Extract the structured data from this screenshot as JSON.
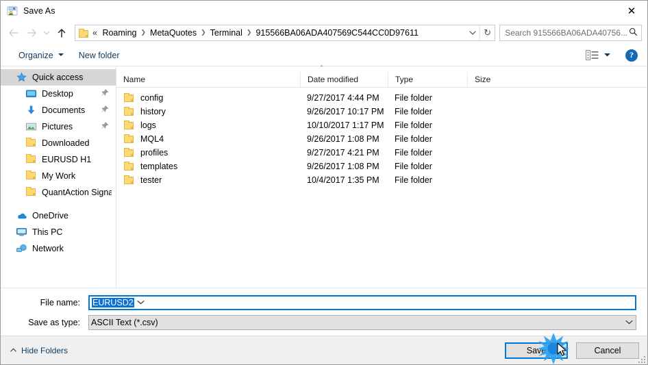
{
  "window": {
    "title": "Save As",
    "title_icon": "save-as-icon",
    "close_label": "✕"
  },
  "nav": {
    "back_icon": "arrow-left-icon",
    "forward_icon": "arrow-right-icon",
    "recent_icon": "chevron-down-icon",
    "up_icon": "arrow-up-icon",
    "address": {
      "folder_icon": "folder-icon",
      "leading": "«",
      "crumbs": [
        "Roaming",
        "MetaQuotes",
        "Terminal",
        "915566BA06ADA407569C544CC0D97611"
      ],
      "separator": "❯",
      "dropdown_icon": "chevron-down-icon",
      "refresh_icon": "refresh-icon",
      "refresh_glyph": "↻"
    },
    "search": {
      "placeholder": "Search 915566BA06ADA40756...",
      "icon": "search-icon",
      "glyph": "⚲"
    }
  },
  "command_bar": {
    "organize": "Organize",
    "new_folder": "New folder",
    "caret": "▼",
    "view_icon": "view-options-icon",
    "view_caret": "▼",
    "help_label": "?"
  },
  "sidebar": {
    "items": [
      {
        "label": "Quick access",
        "icon": "star-pin-icon",
        "selected": true,
        "indent": false,
        "pinned": false
      },
      {
        "label": "Desktop",
        "icon": "desktop-icon",
        "selected": false,
        "indent": true,
        "pinned": true
      },
      {
        "label": "Documents",
        "icon": "documents-icon",
        "selected": false,
        "indent": true,
        "pinned": true
      },
      {
        "label": "Pictures",
        "icon": "pictures-icon",
        "selected": false,
        "indent": true,
        "pinned": true
      },
      {
        "label": "Downloaded",
        "icon": "folder-icon",
        "selected": false,
        "indent": true,
        "pinned": false
      },
      {
        "label": "EURUSD H1",
        "icon": "folder-icon",
        "selected": false,
        "indent": true,
        "pinned": false
      },
      {
        "label": "My Work",
        "icon": "folder-icon",
        "selected": false,
        "indent": true,
        "pinned": false
      },
      {
        "label": "QuantAction Signal",
        "icon": "folder-icon",
        "selected": false,
        "indent": true,
        "pinned": false
      }
    ],
    "roots": [
      {
        "label": "OneDrive",
        "icon": "onedrive-icon"
      },
      {
        "label": "This PC",
        "icon": "this-pc-icon"
      },
      {
        "label": "Network",
        "icon": "network-icon"
      }
    ],
    "pin_glyph": "📌"
  },
  "file_list": {
    "sort_indicator": "˄",
    "columns": [
      "Name",
      "Date modified",
      "Type",
      "Size"
    ],
    "rows": [
      {
        "name": "config",
        "date": "9/27/2017 4:44 PM",
        "type": "File folder",
        "size": ""
      },
      {
        "name": "history",
        "date": "9/26/2017 10:17 PM",
        "type": "File folder",
        "size": ""
      },
      {
        "name": "logs",
        "date": "10/10/2017 1:17 PM",
        "type": "File folder",
        "size": ""
      },
      {
        "name": "MQL4",
        "date": "9/26/2017 1:08 PM",
        "type": "File folder",
        "size": ""
      },
      {
        "name": "profiles",
        "date": "9/27/2017 4:21 PM",
        "type": "File folder",
        "size": ""
      },
      {
        "name": "templates",
        "date": "9/26/2017 1:08 PM",
        "type": "File folder",
        "size": ""
      },
      {
        "name": "tester",
        "date": "10/4/2017 1:35 PM",
        "type": "File folder",
        "size": ""
      }
    ]
  },
  "form": {
    "file_name_label": "File name:",
    "file_name_value": "EURUSD2",
    "save_type_label": "Save as type:",
    "save_type_value": "ASCII Text (*.csv)",
    "chevron": "⌄"
  },
  "footer": {
    "hide_folders": "Hide Folders",
    "hide_caret": "˄",
    "save": "Save",
    "cancel": "Cancel"
  },
  "colors": {
    "accent": "#0078d7",
    "selection": "#0b72d4",
    "folder": "#fcd975",
    "link": "#11395c",
    "help": "#1669b5"
  },
  "cursor": {
    "click_effect": "blue-starburst",
    "pointer": "arrow-cursor"
  }
}
